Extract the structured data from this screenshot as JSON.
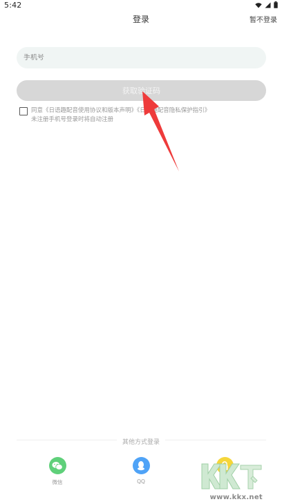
{
  "status_bar": {
    "time": "5:42"
  },
  "header": {
    "title": "登录",
    "skip_label": "暂不登录"
  },
  "phone_input": {
    "value": "",
    "placeholder": "手机号"
  },
  "code_button": {
    "label": "获取验证码"
  },
  "agreement": {
    "checked": false,
    "prefix": "同意",
    "user_agreement": "《日语趣配音使用协议和版本声明》",
    "connector": "",
    "privacy_policy": "《日语趣配音隐私保护指引》",
    "sub_text": "未注册手机号登录时将自动注册"
  },
  "other_login": {
    "title": "其他方式登录",
    "options": [
      {
        "label": "微信",
        "icon": "wechat-icon",
        "color": "#5fd07a"
      },
      {
        "label": "QQ",
        "icon": "qq-icon",
        "color": "#4fa3f7"
      },
      {
        "label": "",
        "icon": "lock-icon",
        "color": "#f5d63a"
      }
    ]
  },
  "watermark": {
    "text": "KKX下载",
    "url": "www.kkx.net"
  },
  "colors": {
    "input_bg": "#f0f5f4",
    "button_disabled": "#d7d7d7",
    "annotation_red": "#ee3b3b"
  }
}
